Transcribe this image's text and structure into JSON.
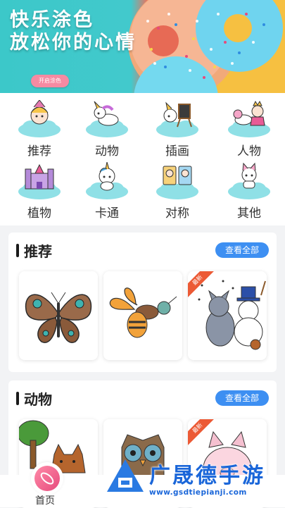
{
  "banner": {
    "line1": "快乐涂色",
    "line2": "放松你的心情",
    "button": "开启涂色"
  },
  "categories": [
    {
      "label": "推荐",
      "icon": "unicorn-girl-icon"
    },
    {
      "label": "动物",
      "icon": "unicorn-icon"
    },
    {
      "label": "插画",
      "icon": "easel-icon"
    },
    {
      "label": "人物",
      "icon": "princess-icon"
    },
    {
      "label": "植物",
      "icon": "castle-icon"
    },
    {
      "label": "卡通",
      "icon": "cartoon-unicorn-icon"
    },
    {
      "label": "对称",
      "icon": "cards-icon"
    },
    {
      "label": "其他",
      "icon": "cat-icon"
    }
  ],
  "sections": [
    {
      "title": "推荐",
      "more": "查看全部",
      "items": [
        {
          "name": "butterfly",
          "badge": ""
        },
        {
          "name": "bee",
          "badge": ""
        },
        {
          "name": "tom-and-jerry",
          "badge": "最新"
        }
      ]
    },
    {
      "title": "动物",
      "more": "查看全部",
      "items": [
        {
          "name": "fox",
          "badge": ""
        },
        {
          "name": "owl",
          "badge": ""
        },
        {
          "name": "pig",
          "badge": "最新"
        }
      ]
    }
  ],
  "tabbar": {
    "home": "首页"
  },
  "watermark": {
    "text": "广晟德手游",
    "url": "www.gsdtiepianji.com"
  },
  "colors": {
    "accent": "#3d8ff2",
    "cloud": "#7fd8e0",
    "ribbon": "#ec5a35"
  }
}
